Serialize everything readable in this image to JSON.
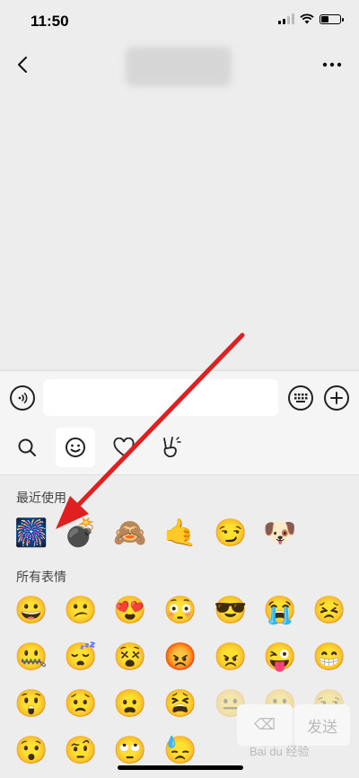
{
  "status_bar": {
    "time": "11:50"
  },
  "input_bar": {
    "text": ""
  },
  "panel": {
    "tabs": [
      {
        "name": "search-tab",
        "icon": "search-icon"
      },
      {
        "name": "emoji-tab",
        "icon": "smiley-icon"
      },
      {
        "name": "favorites-tab",
        "icon": "heart-icon"
      },
      {
        "name": "gesture-tab",
        "icon": "victory-hand-icon"
      }
    ],
    "recent_title": "最近使用",
    "recent": [
      "🎆",
      "💣",
      "🙈",
      "🤙",
      "😏",
      "🐶"
    ],
    "all_title": "所有表情",
    "grid": [
      [
        "😀",
        "😕",
        "😍",
        "😳",
        "😎",
        "😭",
        "😣"
      ],
      [
        "🤐",
        "😴",
        "😵",
        "😡",
        "😠",
        "😜",
        "😁"
      ],
      [
        "😲",
        "😟",
        "😦",
        "😫",
        "😐",
        "😶",
        "😒"
      ],
      [
        "😯",
        "🤨",
        "🙄",
        "😓",
        "",
        "",
        ""
      ]
    ],
    "delete_label": "⌫",
    "send_label": "发送"
  },
  "watermark": "Bai du 经验",
  "colors": {
    "arrow": "#e02020",
    "accent": "#ededed"
  }
}
